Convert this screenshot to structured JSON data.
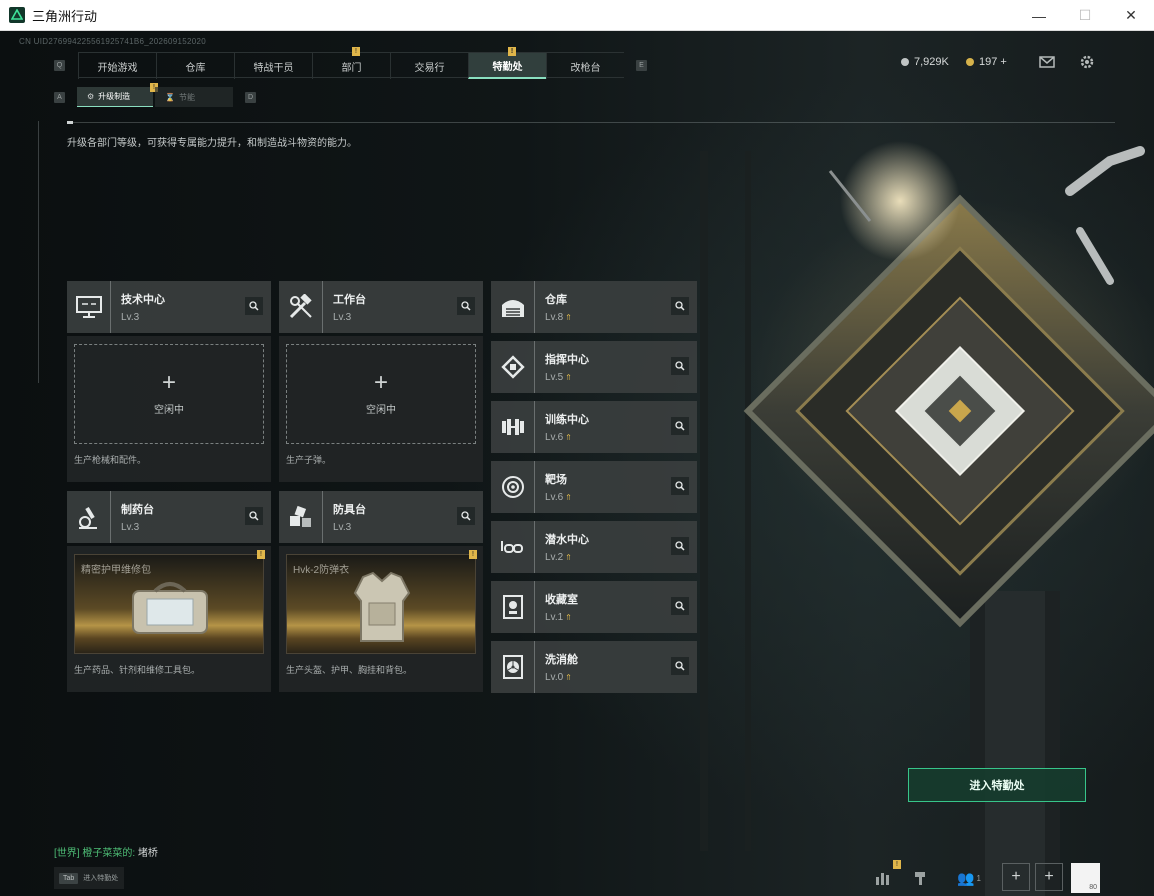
{
  "window": {
    "title": "三角洲行动",
    "minimize": "—",
    "maximize": "☐",
    "close": "✕"
  },
  "uid": "CN UID276994225561925741B6_202609152020",
  "nav": {
    "left_key": "Q",
    "right_key": "E",
    "tabs": [
      {
        "label": "开始游戏"
      },
      {
        "label": "仓库"
      },
      {
        "label": "特战干员"
      },
      {
        "label": "部门"
      },
      {
        "label": "交易行"
      },
      {
        "label": "特勤处"
      },
      {
        "label": "改枪台"
      }
    ],
    "badge": "!"
  },
  "currency": {
    "coins": "7,929K",
    "tokens": "197 +"
  },
  "sub_nav": {
    "left_key": "A",
    "right_key": "D",
    "tabs": [
      {
        "label": "升级制造"
      },
      {
        "label": "节能"
      }
    ],
    "badge": "!"
  },
  "description": "升级各部门等级，可获得专属能力提升，和制造战斗物资的能力。",
  "workbenches": [
    {
      "name": "技术中心",
      "level": "Lv.3",
      "status": "空闲中",
      "caption": "生产枪械和配件。"
    },
    {
      "name": "工作台",
      "level": "Lv.3",
      "status": "空闲中",
      "caption": "生产子弹。"
    },
    {
      "name": "制药台",
      "level": "Lv.3",
      "item": "精密护甲维修包",
      "caption": "生产药品、针剂和维修工具包。"
    },
    {
      "name": "防具台",
      "level": "Lv.3",
      "item": "Hvk-2防弹衣",
      "caption": "生产头盔、护甲、胸挂和背包。"
    }
  ],
  "empty_plus": "+",
  "departments": [
    {
      "name": "仓库",
      "level": "Lv.8"
    },
    {
      "name": "指挥中心",
      "level": "Lv.5"
    },
    {
      "name": "训练中心",
      "level": "Lv.6"
    },
    {
      "name": "靶场",
      "level": "Lv.6"
    },
    {
      "name": "潜水中心",
      "level": "Lv.2"
    },
    {
      "name": "收藏室",
      "level": "Lv.1"
    },
    {
      "name": "洗消舱",
      "level": "Lv.0"
    }
  ],
  "enter_button": "进入特勤处",
  "chat": {
    "channel": "[世界]",
    "user": "橙子菜菜的:",
    "message": "堵桥"
  },
  "tab_hint": {
    "key": "Tab",
    "label": "进入特勤处"
  },
  "bottom": {
    "badge": "!",
    "friends_count": "1",
    "plus": "+",
    "avatar_level": "80"
  },
  "colors": {
    "accent_green": "#37c58a",
    "active_tab_underline": "#8adfc0",
    "badge_yellow": "#e0b64a",
    "upgrade_gold": "#d6b24b"
  }
}
